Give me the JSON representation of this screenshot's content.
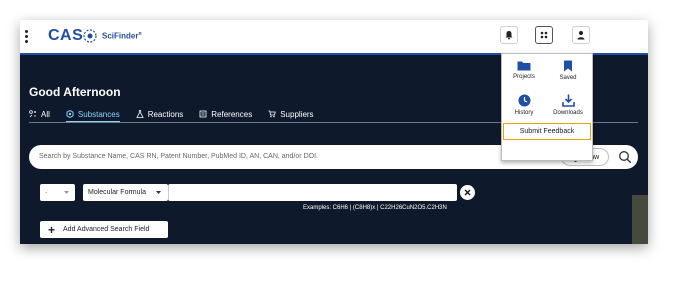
{
  "app": {
    "brand": "CAS",
    "product": "SciFinder",
    "product_mark": "n",
    "brand_color": "#1f4fa6"
  },
  "topbar": {
    "menu_icon": "kebab-menu-icon",
    "buttons": [
      {
        "name": "notifications",
        "icon": "bell-icon"
      },
      {
        "name": "apps",
        "icon": "grid-icon",
        "active": true
      },
      {
        "name": "account",
        "icon": "user-icon"
      }
    ]
  },
  "apps_menu": {
    "items": [
      {
        "label": "Projects",
        "icon": "folder-icon"
      },
      {
        "label": "Saved",
        "icon": "bookmark-icon"
      },
      {
        "label": "History",
        "icon": "clock-icon"
      },
      {
        "label": "Downloads",
        "icon": "download-icon"
      }
    ],
    "feedback_label": "Submit Feedback"
  },
  "main": {
    "greeting": "Good Afternoon",
    "tabs": [
      {
        "label": "All",
        "icon": "all-icon"
      },
      {
        "label": "Substances",
        "icon": "hexagon-icon",
        "active": true
      },
      {
        "label": "Reactions",
        "icon": "flask-icon"
      },
      {
        "label": "References",
        "icon": "document-icon"
      },
      {
        "label": "Suppliers",
        "icon": "cart-icon"
      }
    ],
    "search": {
      "placeholder": "Search by Substance Name, CAS RN, Patent Number, PubMed ID, AN, CAN, and/or DOI.",
      "draw_label": "Draw"
    },
    "advanced": {
      "operator_value": "-",
      "field_value": "Molecular Formula",
      "input_value": "",
      "examples": "Examples: C6H6 | (C8H8)x | C22H26CuN2O5.C2H3N",
      "add_label": "Add Advanced Search Field"
    }
  }
}
